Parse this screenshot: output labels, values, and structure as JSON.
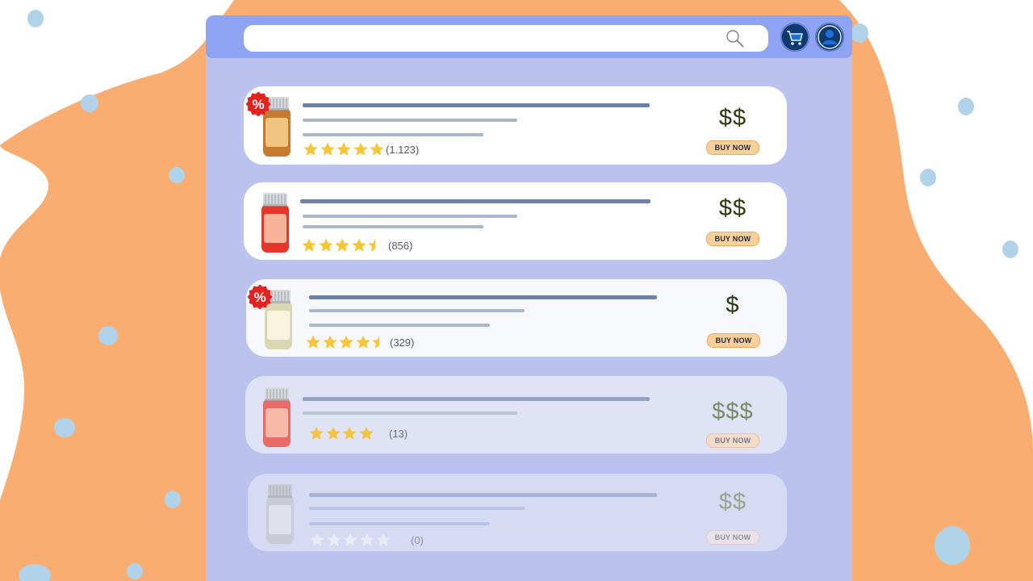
{
  "search": {
    "placeholder": ""
  },
  "icons": {
    "search": "search-icon",
    "cart": "cart-icon",
    "user": "user-icon",
    "discount": "percent-badge-icon",
    "star": "star-icon"
  },
  "colors": {
    "bottle_amber": "#c8772d",
    "bottle_red": "#e0322a",
    "bottle_cream": "#dcd7b3",
    "accent_orange": "#f7ad6c",
    "star": "#f8c537"
  },
  "products": [
    {
      "rating_stars": 5,
      "rating_count": "(1.123)",
      "price": "$$",
      "buy_label": "BUY NOW",
      "discount": true,
      "discount_label": "%"
    },
    {
      "rating_stars": 4.5,
      "rating_count": "(856)",
      "price": "$$",
      "buy_label": "BUY NOW",
      "discount": false
    },
    {
      "rating_stars": 4.5,
      "rating_count": "(329)",
      "price": "$",
      "buy_label": "BUY NOW",
      "discount": true,
      "discount_label": "%"
    },
    {
      "rating_stars": 4,
      "rating_count": "(13)",
      "price": "$$$",
      "buy_label": "BUY NOW",
      "discount": false
    },
    {
      "rating_stars": 0,
      "rating_count": "(0)",
      "price": "$$",
      "buy_label": "BUY NOW",
      "discount": false
    }
  ]
}
